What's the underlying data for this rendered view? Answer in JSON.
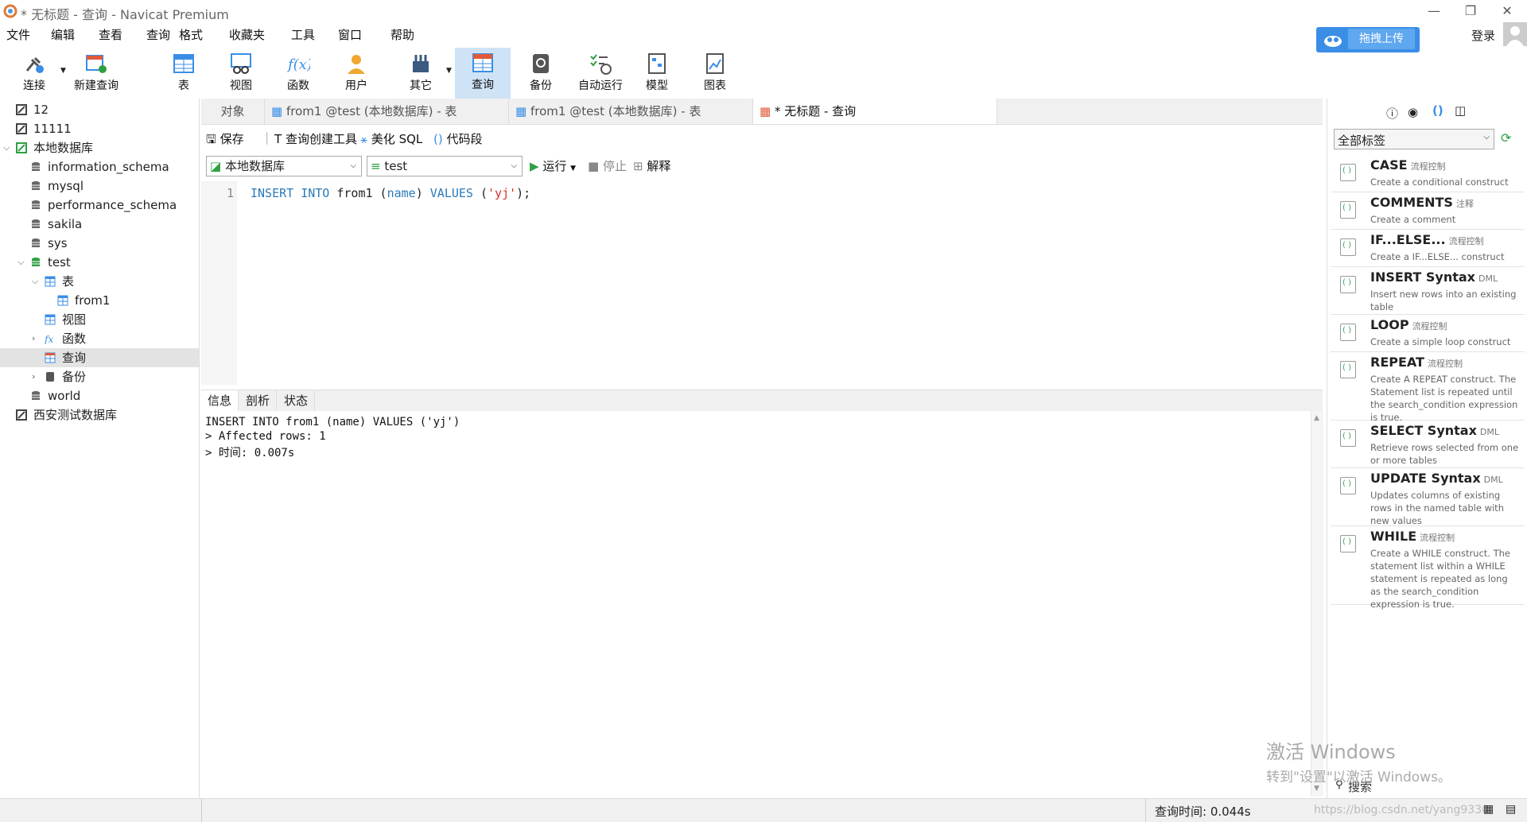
{
  "window": {
    "title": "* 无标题 - 查询 - Navicat Premium",
    "minimize": "—",
    "restore": "❐",
    "close": "✕"
  },
  "menu": [
    "文件",
    "编辑",
    "查看",
    "查询",
    "格式",
    "收藏夹",
    "工具",
    "窗口",
    "帮助"
  ],
  "account": {
    "cloud_upload": "拖拽上传",
    "login": "登录"
  },
  "toolbar": [
    {
      "label": "连接",
      "icon": "connection-icon"
    },
    {
      "label": "新建查询",
      "icon": "new-query-icon"
    },
    {
      "label": "表",
      "icon": "table-icon"
    },
    {
      "label": "视图",
      "icon": "view-icon"
    },
    {
      "label": "函数",
      "icon": "function-icon"
    },
    {
      "label": "用户",
      "icon": "user-icon"
    },
    {
      "label": "其它",
      "icon": "other-icon"
    },
    {
      "label": "查询",
      "icon": "query-icon"
    },
    {
      "label": "备份",
      "icon": "backup-icon"
    },
    {
      "label": "自动运行",
      "icon": "auto-run-icon"
    },
    {
      "label": "模型",
      "icon": "model-icon"
    },
    {
      "label": "图表",
      "icon": "chart-icon"
    }
  ],
  "tree": [
    {
      "label": "12",
      "level": 0,
      "icon": "connection-icon"
    },
    {
      "label": "11111",
      "level": 0,
      "icon": "connection-icon"
    },
    {
      "label": "本地数据库",
      "level": 0,
      "icon": "connection-open-icon",
      "expanded": true
    },
    {
      "label": "information_schema",
      "level": 1,
      "icon": "database-icon"
    },
    {
      "label": "mysql",
      "level": 1,
      "icon": "database-icon"
    },
    {
      "label": "performance_schema",
      "level": 1,
      "icon": "database-icon"
    },
    {
      "label": "sakila",
      "level": 1,
      "icon": "database-icon"
    },
    {
      "label": "sys",
      "level": 1,
      "icon": "database-icon"
    },
    {
      "label": "test",
      "level": 1,
      "icon": "database-open-icon",
      "expanded": true
    },
    {
      "label": "表",
      "level": 2,
      "icon": "table-folder-icon",
      "expanded": true
    },
    {
      "label": "from1",
      "level": 3,
      "icon": "table-icon"
    },
    {
      "label": "视图",
      "level": 2,
      "icon": "view-folder-icon"
    },
    {
      "label": "函数",
      "level": 2,
      "icon": "function-folder-icon",
      "collapsed": true
    },
    {
      "label": "查询",
      "level": 2,
      "icon": "query-folder-icon",
      "selected": true
    },
    {
      "label": "备份",
      "level": 2,
      "icon": "backup-folder-icon",
      "collapsed": true
    },
    {
      "label": "world",
      "level": 1,
      "icon": "database-icon"
    },
    {
      "label": "西安测试数据库",
      "level": 0,
      "icon": "connection-icon"
    }
  ],
  "tabs": [
    {
      "label": "对象"
    },
    {
      "label": "from1 @test (本地数据库) - 表"
    },
    {
      "label": "from1 @test (本地数据库) - 表"
    },
    {
      "label": "* 无标题 - 查询",
      "active": true
    }
  ],
  "query_toolbar": {
    "save": "保存",
    "builder": "查询创建工具",
    "beautify": "美化 SQL",
    "snippet": "代码段"
  },
  "selectors": {
    "connection": "本地数据库",
    "database": "test",
    "run": "运行",
    "stop": "停止",
    "explain": "解释"
  },
  "editor": {
    "line_number": "1",
    "tokens": [
      {
        "t": "INSERT",
        "c": "#2a7ab8"
      },
      {
        "t": " ",
        "c": "#222"
      },
      {
        "t": "INTO",
        "c": "#2a7ab8"
      },
      {
        "t": " from1 (",
        "c": "#222"
      },
      {
        "t": "name",
        "c": "#2a7ab8"
      },
      {
        "t": ") ",
        "c": "#222"
      },
      {
        "t": "VALUES",
        "c": "#2a7ab8"
      },
      {
        "t": " (",
        "c": "#222"
      },
      {
        "t": "'yj'",
        "c": "#d0352a"
      },
      {
        "t": ");",
        "c": "#222"
      }
    ]
  },
  "result_tabs": [
    "信息",
    "剖析",
    "状态"
  ],
  "output": [
    "INSERT INTO from1 (name) VALUES ('yj')",
    "> Affected rows: 1",
    "> 时间: 0.007s"
  ],
  "right_panel": {
    "tag_filter": "全部标签",
    "search_placeholder": "搜索",
    "snippets": [
      {
        "name": "CASE",
        "category": "流程控制",
        "desc": "Create a conditional construct"
      },
      {
        "name": "COMMENTS",
        "category": "注释",
        "desc": "Create a comment"
      },
      {
        "name": "IF...ELSE...",
        "category": "流程控制",
        "desc": "Create a IF...ELSE... construct"
      },
      {
        "name": "INSERT Syntax",
        "category": "DML",
        "desc": "Insert new rows into an existing table"
      },
      {
        "name": "LOOP",
        "category": "流程控制",
        "desc": "Create a simple loop construct"
      },
      {
        "name": "REPEAT",
        "category": "流程控制",
        "desc": "Create A REPEAT construct. The Statement list is repeated until the search_condition expression is true."
      },
      {
        "name": "SELECT Syntax",
        "category": "DML",
        "desc": "Retrieve rows selected from one or more tables"
      },
      {
        "name": "UPDATE Syntax",
        "category": "DML",
        "desc": "Updates columns of existing rows in the named table with new values"
      },
      {
        "name": "WHILE",
        "category": "流程控制",
        "desc": "Create a WHILE construct. The statement list within a WHILE statement is repeated as long as the search_condition expression is true."
      }
    ]
  },
  "status": {
    "query_time": "查询时间: 0.044s",
    "url_watermark": "https://blog.csdn.net/yang9330"
  },
  "watermark": {
    "line1": "激活 Windows",
    "line2": "转到\"设置\"以激活 Windows。"
  },
  "colors": {
    "accent": "#3a8ee6",
    "selected_tab_bg": "#cfe3f7",
    "keyword": "#2a7ab8",
    "string": "#d0352a",
    "db_green": "#2ea043"
  }
}
